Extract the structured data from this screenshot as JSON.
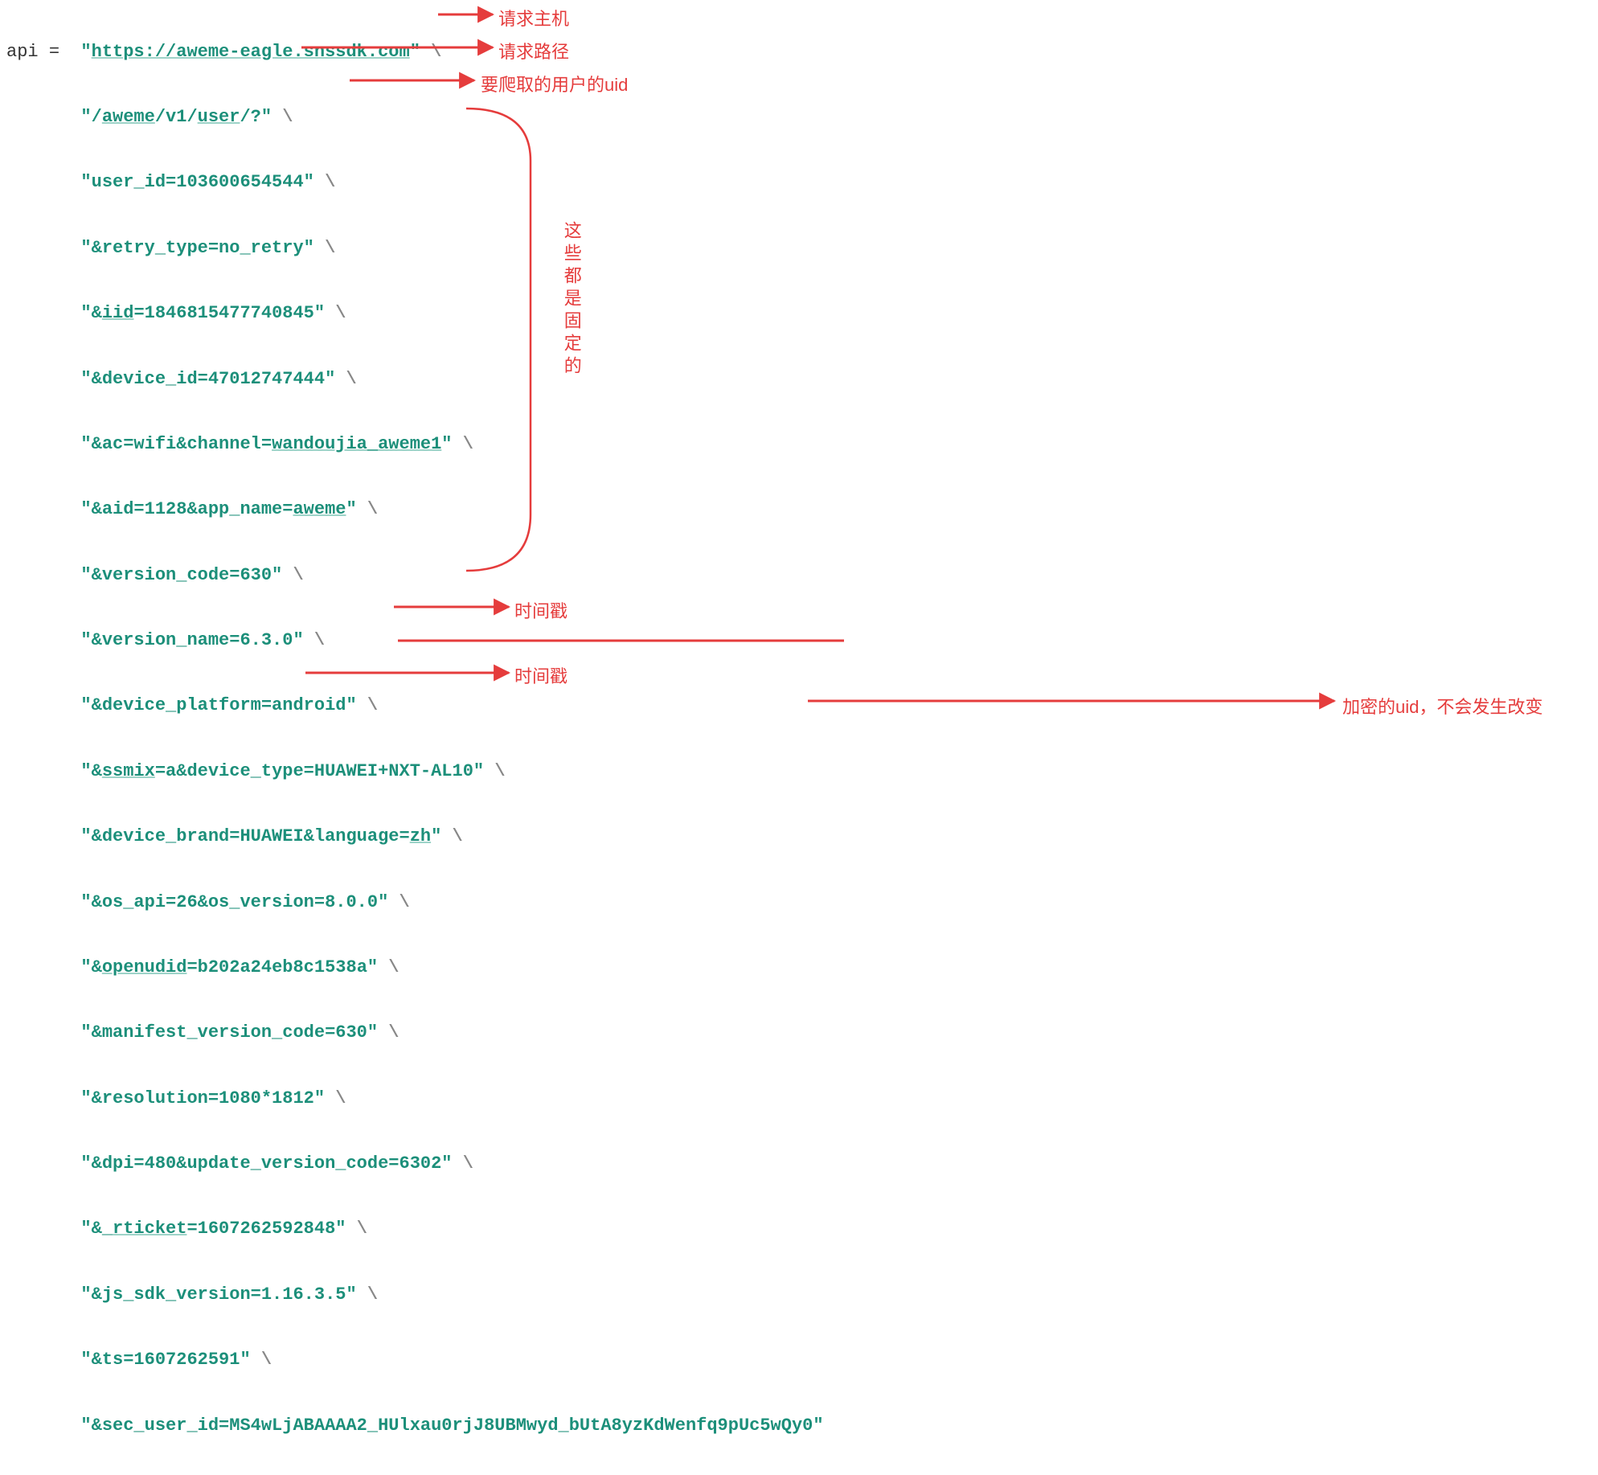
{
  "code": {
    "var": "api",
    "eq": "=",
    "lines": [
      {
        "pre": "\"",
        "u": "https://aweme-eagle.snssdk.com",
        "post": "\""
      },
      {
        "pre": "\"/",
        "u": "aweme",
        "mid1": "/v1/",
        "u2": "user",
        "post": "/?\""
      },
      {
        "pre": "\"user_id=103600654544\""
      },
      {
        "pre": "\"&retry_type=no_retry\""
      },
      {
        "pre": "\"&",
        "u": "iid",
        "post": "=1846815477740845\""
      },
      {
        "pre": "\"&device_id=47012747444\""
      },
      {
        "pre": "\"&ac=wifi&channel=",
        "u": "wandoujia_aweme1",
        "post": "\""
      },
      {
        "pre": "\"&aid=1128&app_name=",
        "u": "aweme",
        "post": "\""
      },
      {
        "pre": "\"&version_code=630\""
      },
      {
        "pre": "\"&version_name=6.3.0\""
      },
      {
        "pre": "\"&device_platform=android\""
      },
      {
        "pre": "\"&",
        "u": "ssmix",
        "post": "=a&device_type=HUAWEI+NXT-AL10\""
      },
      {
        "pre": "\"&device_brand=HUAWEI&language=",
        "u": "zh",
        "post": "\""
      },
      {
        "pre": "\"&os_api=26&os_version=8.0.0\""
      },
      {
        "pre": "\"&",
        "u": "openudid",
        "post": "=b202a24eb8c1538a\""
      },
      {
        "pre": "\"&manifest_version_code=630\""
      },
      {
        "pre": "\"&resolution=1080*1812\""
      },
      {
        "pre": "\"&dpi=480&update_version_code=6302\""
      },
      {
        "pre": "\"&_",
        "u": "rticket",
        "post": "=1607262592848\""
      },
      {
        "pre": "\"&js_sdk_version=1.16.3.5\""
      },
      {
        "pre": "\"&ts=1607262591\""
      },
      {
        "pre": "\"&sec_user_id=MS4wLjABAAAA2_HUlxau0rjJ8UBMwyd_bUtA8yzKdWenfq9pUc5wQy0\""
      }
    ],
    "backslash": "\\"
  },
  "annotations": {
    "host": "请求主机",
    "path": "请求路径",
    "uid": "要爬取的用户的uid",
    "fixed": "这些都是固定的",
    "ts1": "时间戳",
    "ts2": "时间戳",
    "encuid": "加密的uid，不会发生改变"
  }
}
